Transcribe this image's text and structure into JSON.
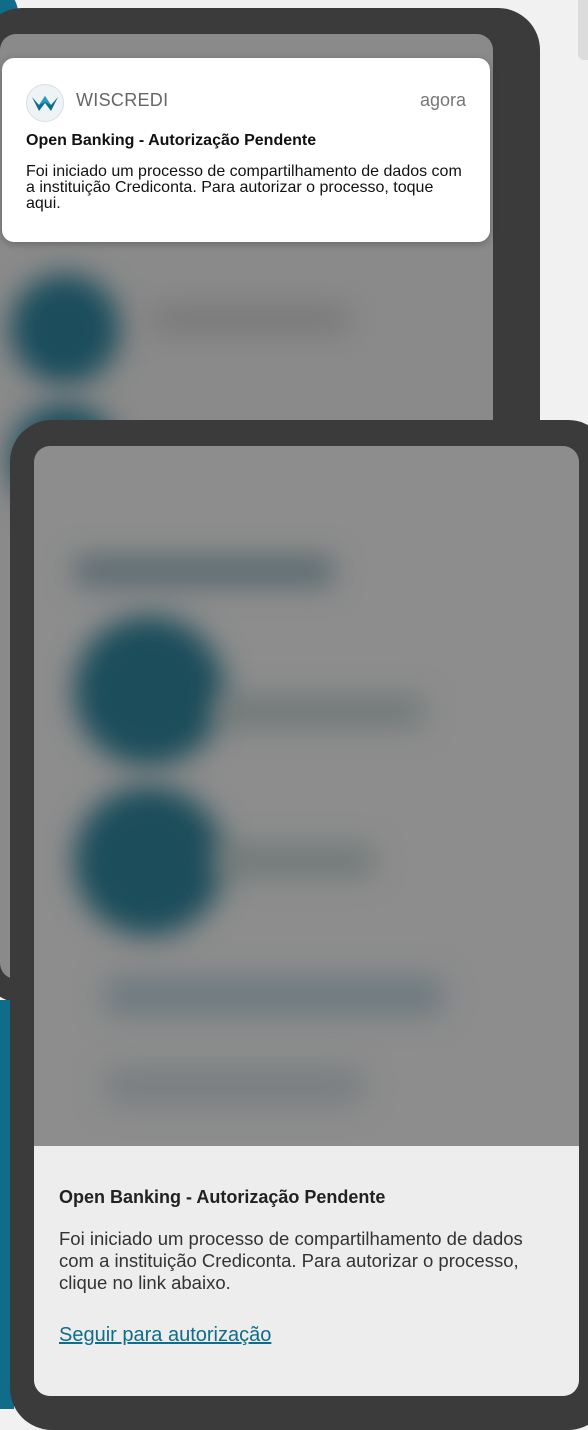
{
  "notification": {
    "app_name": "WISCREDI",
    "time": "agora",
    "title": "Open Banking - Autorização Pendente",
    "body": "Foi iniciado um processo de compartilhamento de dados com a instituição Crediconta. Para autorizar o processo, toque aqui."
  },
  "sheet": {
    "title": "Open Banking - Autorização Pendente",
    "body": "Foi iniciado um processo de compartilhamento de dados com a instituição Crediconta. Para autorizar o processo, clique no link abaixo.",
    "link": "Seguir para autorização"
  },
  "colors": {
    "accent": "#0f6d89",
    "frame": "#3b3b3b",
    "overlay": "#8a8a8a",
    "sheet_bg": "#ededed"
  },
  "icons": {
    "app_logo": "wiscredi-star-logo-icon"
  }
}
